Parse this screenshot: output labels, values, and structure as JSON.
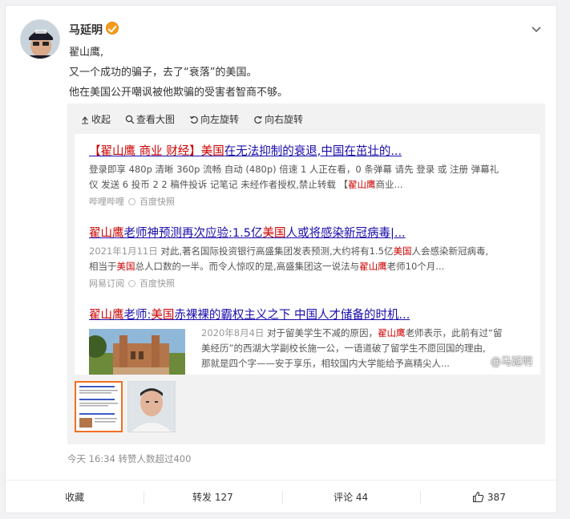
{
  "post": {
    "author": "马延明",
    "lines": [
      "翟山鹰,",
      "又一个成功的骗子，去了“衰落”的美国。",
      "他在美国公开嘲讽被他欺骗的受害者智商不够。"
    ],
    "meta": "今天 16:34 转赞人数超过400"
  },
  "toolbar": {
    "collapse": "收起",
    "view_large": "查看大图",
    "rotate_left": "向左旋转",
    "rotate_right": "向右旋转"
  },
  "results": [
    {
      "title_hl1": "【翟山鹰 商业 财经】",
      "title_hl2": "美国",
      "title_rest": "在无法抑制的衰退,中国在茁壮的...",
      "desc1": "登录即享 480p 清晰 360p 流畅 自动 (480p) 倍速 1 人正在看，0 条弹幕 请先 登录 或 注册 弹幕礼",
      "desc2_pre": "仪 发送 6 投币 2 2 稿件投诉 记笔记 未经作者授权,禁止转载 【",
      "desc2_hl": "翟山鹰",
      "desc2_post": "商业...",
      "source": "哔哩哔哩",
      "cache": "百度快照"
    },
    {
      "title_hl1": "翟山鹰",
      "title_mid": "老师神预测再次应验:1.5亿",
      "title_hl2": "美国",
      "title_rest": "人或将感染新冠病毒|...",
      "date": "2021年1月11日",
      "desc1_pre": "对此,著名国际投资银行高盛集团发表预测,大约将有1.5亿",
      "desc1_hl": "美国",
      "desc1_post": "人会感染新冠病毒,",
      "desc2_pre": "相当于",
      "desc2_hl": "美国",
      "desc2_mid": "总人口数的一半。而令人惊叹的是,高盛集团这一说法与",
      "desc2_hl2": "翟山鹰",
      "desc2_post": "老师10个月...",
      "source": "网易订阅",
      "cache": "百度快照"
    },
    {
      "title_hl1": "翟山鹰",
      "title_mid": "老师:",
      "title_hl2": "美国",
      "title_rest": "赤裸裸的霸权主义之下 中国人才储备的时机...",
      "date": "2020年8月4日",
      "desc1_pre": "对于留美学生不减的原因，",
      "desc1_hl": "翟山鹰",
      "desc1_post": "老师表示，此前有过“留",
      "desc2": "美经历”的西湖大学副校长施一公，一语道破了留学生不愿回国的理由,",
      "desc3": "那就是四个字——安于享乐，相较国内大学能给予高精尖人..."
    }
  ],
  "watermark": "@马延明",
  "footer": {
    "favorite": "收藏",
    "repost": "转发 127",
    "comment": "评论 44",
    "like": "387"
  }
}
